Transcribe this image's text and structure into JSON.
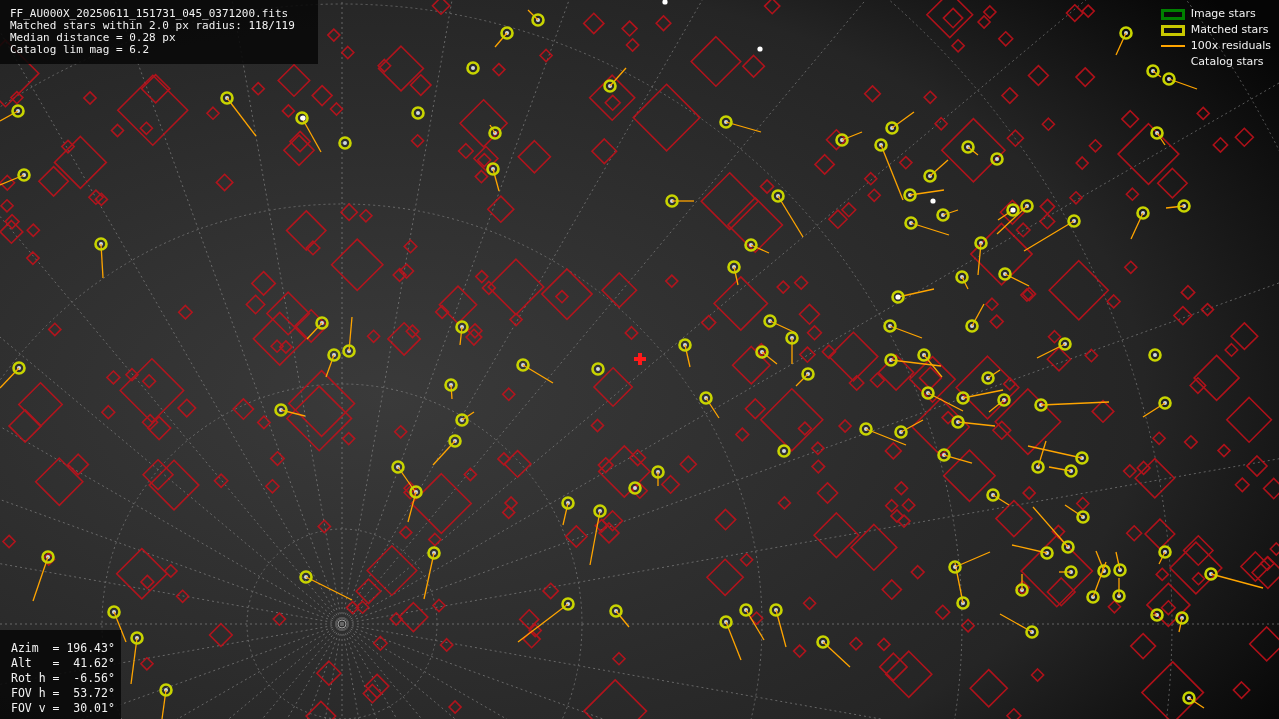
{
  "info": {
    "lines": [
      "FF_AU000X_20250611_151731_045_0371200.fits",
      "Matched stars within 2.0 px radius: 118/119",
      "Median distance = 0.28 px",
      "Catalog lim mag = 6.2"
    ]
  },
  "legend": [
    {
      "label": "Image stars",
      "kind": "box",
      "color": "#008000"
    },
    {
      "label": "Matched stars",
      "kind": "box",
      "color": "#c8c800"
    },
    {
      "label": "100x residuals",
      "kind": "line",
      "color": "#ffa500"
    },
    {
      "label": "Catalog stars",
      "kind": "blank"
    }
  ],
  "pointing": {
    "lines": [
      "Azim  = 196.43°",
      "Alt   =  41.62°",
      "Rot h =  -6.56°",
      "FOV h =  53.72°",
      "FOV v =  30.01°"
    ]
  }
}
